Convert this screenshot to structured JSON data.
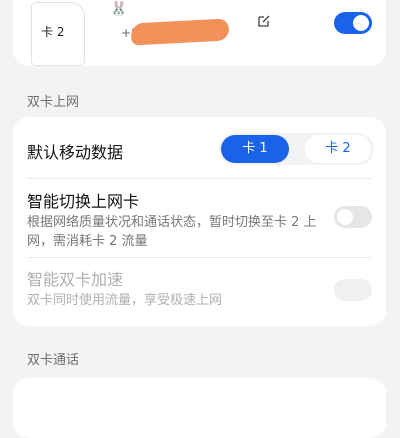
{
  "sim": {
    "icon_label": "卡 2",
    "avatar": "🐰",
    "number": "+86"
  },
  "section_data": {
    "title": "双卡上网"
  },
  "default_data": {
    "label": "默认移动数据",
    "options": [
      "卡 1",
      "卡 2"
    ],
    "selected": "卡 1"
  },
  "smart_switch": {
    "title": "智能切换上网卡",
    "desc": "根据网络质量状况和通话状态，暂时切换至卡 2 上网，需消耗卡 2 流量"
  },
  "dual_accel": {
    "title": "智能双卡加速",
    "desc": "双卡同时使用流量，享受极速上网"
  },
  "section_call": {
    "title": "双卡通话"
  },
  "colors": {
    "accent": "#1a63e8",
    "background": "#f1f3f5"
  }
}
